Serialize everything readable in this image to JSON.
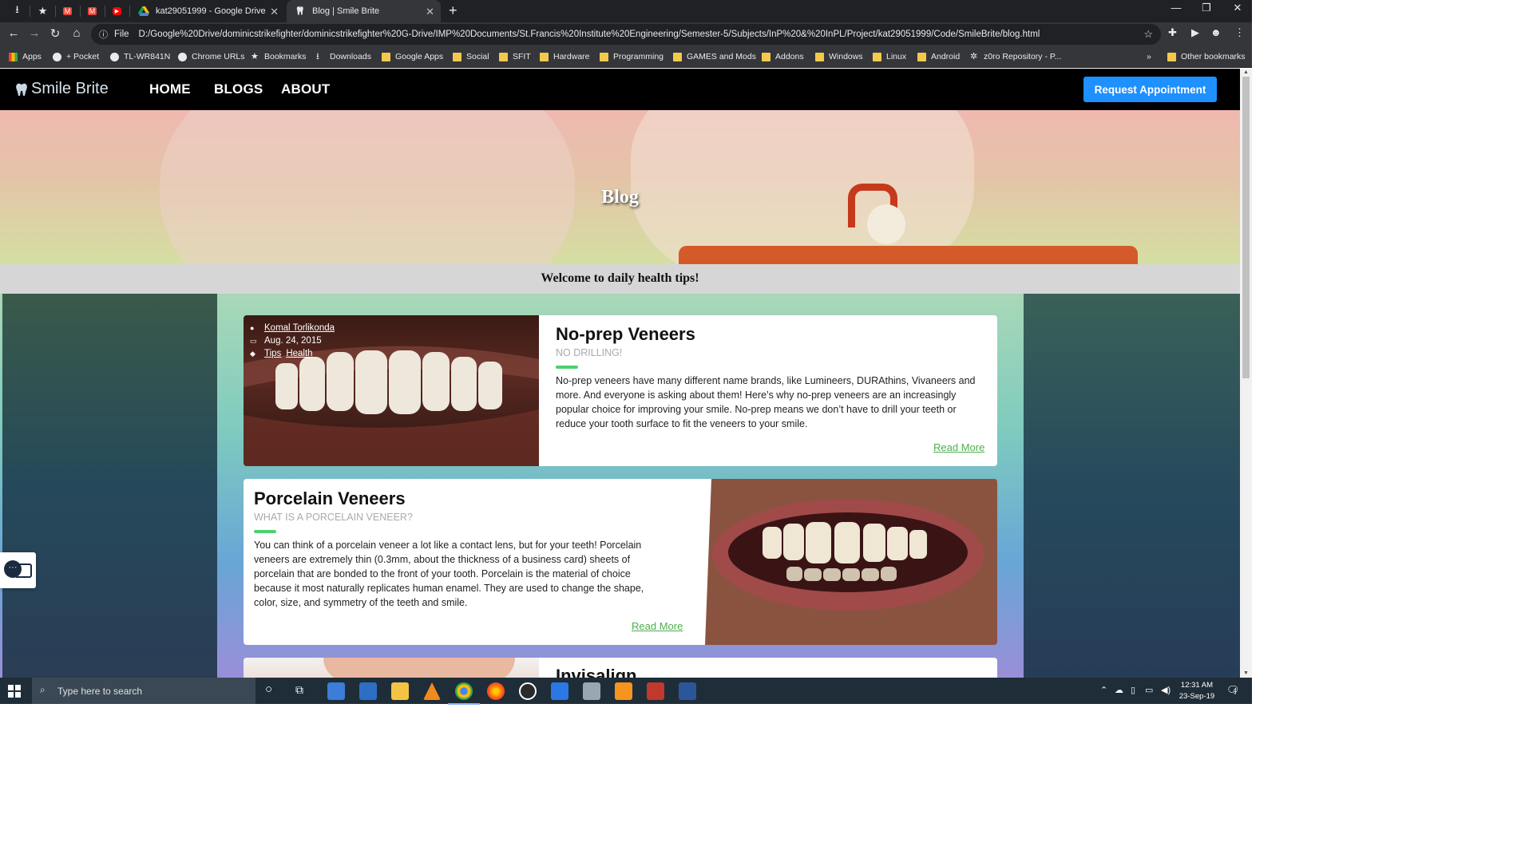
{
  "browser": {
    "tabs": [
      {
        "title": "kat29051999 - Google Drive",
        "active": false
      },
      {
        "title": "Blog | Smile Brite",
        "active": true
      }
    ],
    "address": {
      "scheme": "File",
      "url": "D:/Google%20Drive/dominicstrikefighter/dominicstrikefighter%20G-Drive/IMP%20Documents/St.Francis%20Institute%20Engineering/Semester-5/Subjects/InP%20&%20InPL/Project/kat29051999/Code/SmileBrite/blog.html"
    },
    "bookmarks": [
      "Apps",
      "+ Pocket",
      "TL-WR841N",
      "Chrome URLs",
      "Bookmarks",
      "Downloads",
      "Google Apps",
      "Social",
      "SFIT",
      "Hardware",
      "Programming",
      "GAMES and Mods",
      "Addons",
      "Windows",
      "Linux",
      "Android",
      "z0ro Repository - P...",
      "Other bookmarks"
    ]
  },
  "site": {
    "brand": "Smile Brite",
    "nav": [
      "HOME",
      "BLOGS",
      "ABOUT"
    ],
    "cta": "Request Appointment",
    "hero_title": "Blog",
    "welcome": "Welcome to daily health tips!"
  },
  "posts": [
    {
      "author": "Komal Torlikonda",
      "date": "Aug. 24, 2015",
      "tags": [
        "Tips",
        "Health"
      ],
      "title": "No-prep Veneers",
      "subtitle": "NO DRILLING!",
      "body": "No-prep veneers have many different name brands, like Lumineers, DURAthins, Vivaneers and more. And everyone is asking about them! Here’s why no-prep veneers are an increasingly popular choice for improving your smile. No-prep means we don’t have to drill your teeth or reduce your tooth surface to fit the veneers to your smile.",
      "more": "Read More"
    },
    {
      "title": "Porcelain Veneers",
      "subtitle": "WHAT IS A PORCELAIN VENEER?",
      "body": "You can think of a porcelain veneer a lot like a contact lens, but for your teeth! Porcelain veneers are extremely thin (0.3mm, about the thickness of a business card) sheets of porcelain that are bonded to the front of your tooth. Porcelain is the material of choice because it most naturally replicates human enamel. They are used to change the shape, color, size, and symmetry of the teeth and smile.",
      "more": "Read More"
    },
    {
      "title": "Invisalign"
    }
  ],
  "taskbar": {
    "search_placeholder": "Type here to search",
    "time": "12:31 AM",
    "date": "23-Sep-19",
    "notifications": "4"
  }
}
